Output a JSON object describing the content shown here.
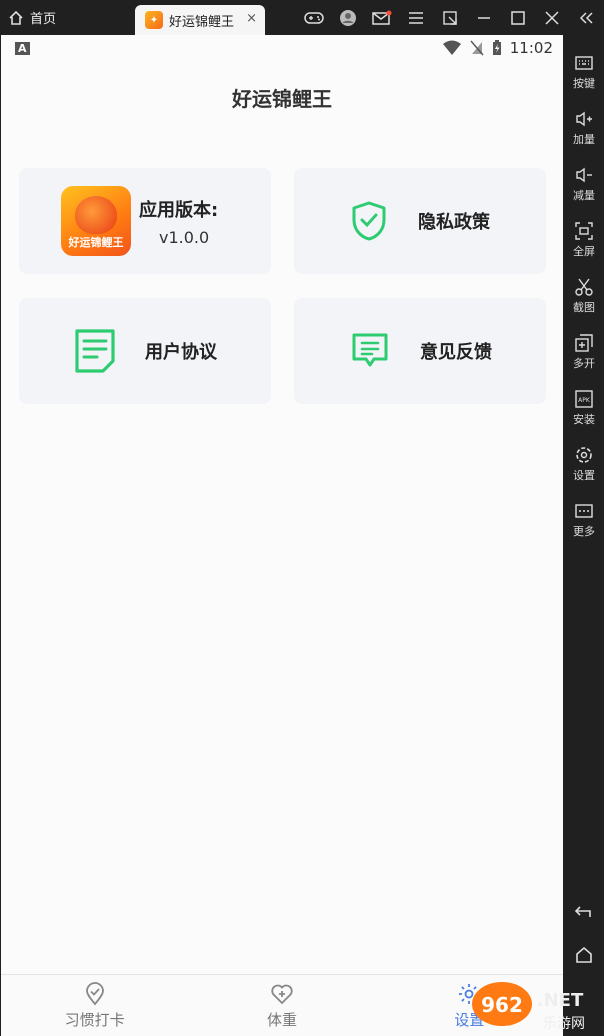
{
  "titlebar": {
    "home_label": "首页",
    "tab_label": "好运锦鲤王",
    "tab_close": "×"
  },
  "statusbar": {
    "left_indicator": "A",
    "time": "11:02"
  },
  "page": {
    "title": "好运锦鲤王"
  },
  "cards": [
    {
      "id": "version",
      "label": "应用版本:",
      "value": "v1.0.0",
      "logo_text": "好运锦鲤王"
    },
    {
      "id": "privacy",
      "label": "隐私政策",
      "icon": "shield-check-icon"
    },
    {
      "id": "agreement",
      "label": "用户协议",
      "icon": "document-icon"
    },
    {
      "id": "feedback",
      "label": "意见反馈",
      "icon": "message-icon"
    }
  ],
  "sidebar": {
    "items": [
      {
        "label": "按键",
        "icon": "keyboard-icon"
      },
      {
        "label": "加量",
        "icon": "volume-up-icon"
      },
      {
        "label": "减量",
        "icon": "volume-down-icon"
      },
      {
        "label": "全屏",
        "icon": "fullscreen-icon"
      },
      {
        "label": "截图",
        "icon": "scissors-icon"
      },
      {
        "label": "多开",
        "icon": "multi-open-icon"
      },
      {
        "label": "安装",
        "icon": "apk-icon"
      },
      {
        "label": "设置",
        "icon": "gear-icon"
      },
      {
        "label": "更多",
        "icon": "more-icon"
      }
    ]
  },
  "bottom_nav": {
    "items": [
      {
        "label": "习惯打卡",
        "icon": "checkin-icon"
      },
      {
        "label": "体重",
        "icon": "heart-plus-icon"
      },
      {
        "label": "设置",
        "icon": "gear-icon"
      }
    ]
  },
  "colors": {
    "accent_green": "#2ecc71",
    "active_blue": "#4a7de2",
    "card_bg": "#f3f4f8"
  },
  "watermark": {
    "text": "962.NET",
    "subtext": "乐游网"
  }
}
